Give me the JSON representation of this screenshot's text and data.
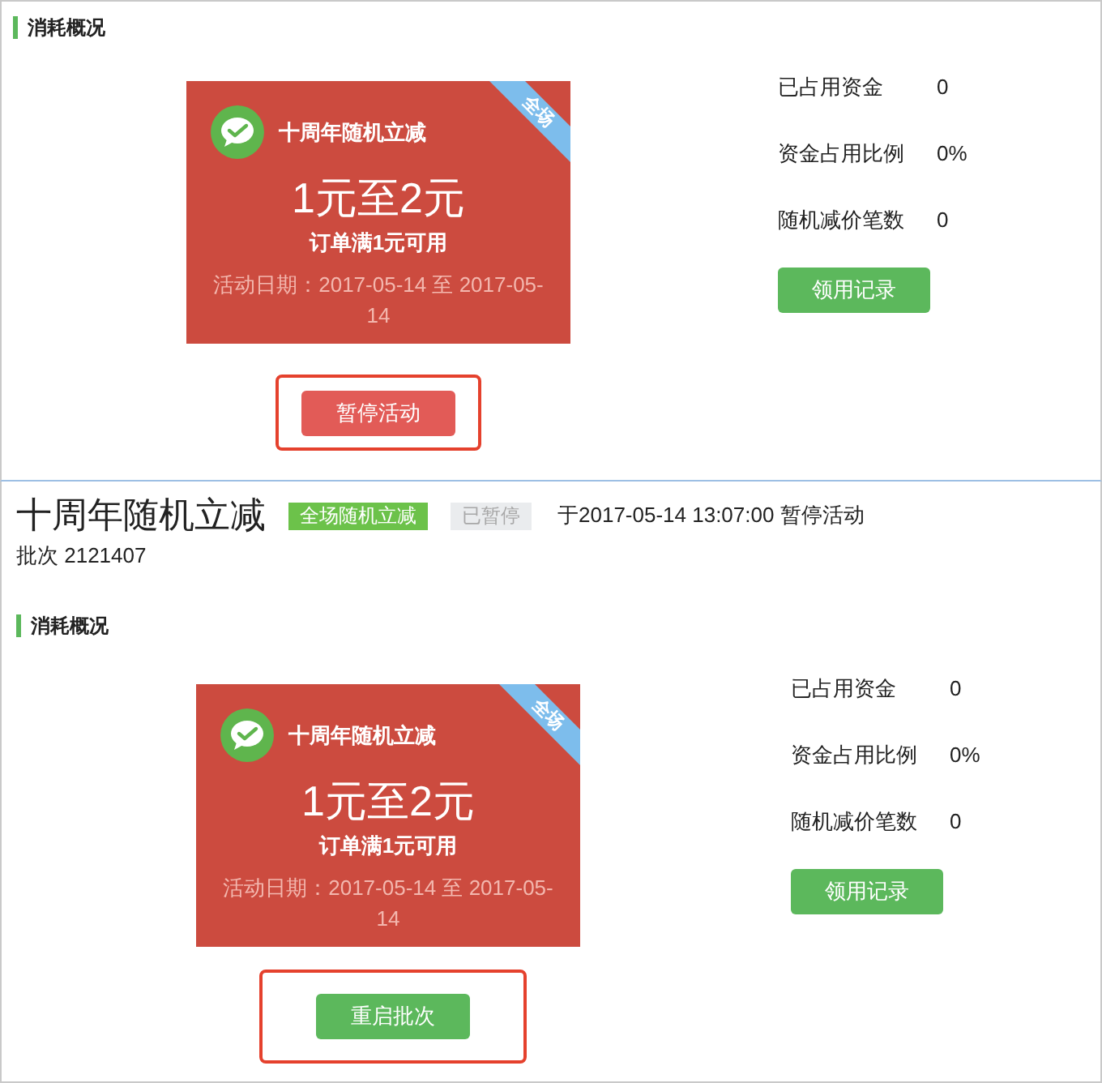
{
  "panels": [
    {
      "section_title": "消耗概况",
      "coupon": {
        "ribbon": "全场",
        "title": "十周年随机立减",
        "amount": "1元至2元",
        "condition": "订单满1元可用",
        "dates": "活动日期：2017-05-14 至 2017-05-14"
      },
      "action_button": {
        "kind": "pause",
        "label": "暂停活动"
      },
      "stats": [
        {
          "label": "已占用资金",
          "value": "0"
        },
        {
          "label": "资金占用比例",
          "value": "0%"
        },
        {
          "label": "随机减价笔数",
          "value": "0"
        }
      ],
      "records_button": "领用记录"
    },
    {
      "header": {
        "title": "十周年随机立减",
        "tags": [
          {
            "kind": "scope",
            "label": "全场随机立减"
          },
          {
            "kind": "status",
            "label": "已暂停"
          }
        ],
        "status_note": "于2017-05-14 13:07:00 暂停活动",
        "batch": "批次 2121407"
      },
      "section_title": "消耗概况",
      "coupon": {
        "ribbon": "全场",
        "title": "十周年随机立减",
        "amount": "1元至2元",
        "condition": "订单满1元可用",
        "dates": "活动日期：2017-05-14 至 2017-05-14"
      },
      "action_button": {
        "kind": "restart",
        "label": "重启批次"
      },
      "stats": [
        {
          "label": "已占用资金",
          "value": "0"
        },
        {
          "label": "资金占用比例",
          "value": "0%"
        },
        {
          "label": "随机减价笔数",
          "value": "0"
        }
      ],
      "records_button": "领用记录"
    }
  ]
}
